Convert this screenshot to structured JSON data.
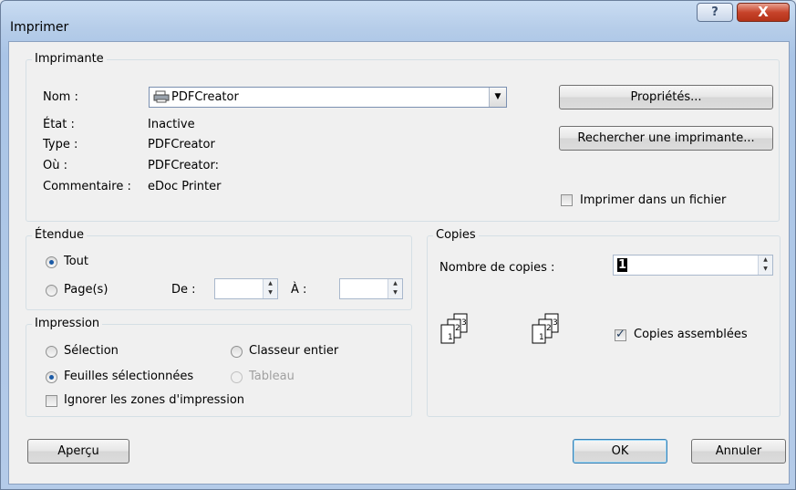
{
  "window": {
    "title": "Imprimer",
    "help_label": "?",
    "close_label": "X"
  },
  "printer": {
    "group_title": "Imprimante",
    "name_label": "Nom :",
    "name_value": "PDFCreator",
    "state_label": "État :",
    "state_value": "Inactive",
    "type_label": "Type :",
    "type_value": "PDFCreator",
    "where_label": "Où :",
    "where_value": "PDFCreator:",
    "comment_label": "Commentaire :",
    "comment_value": "eDoc Printer",
    "properties_button": "Propriétés...",
    "find_printer_button": "Rechercher une imprimante...",
    "print_to_file_label": "Imprimer dans un fichier",
    "print_to_file_checked": false
  },
  "range": {
    "group_title": "Étendue",
    "all_label": "Tout",
    "pages_label": "Page(s)",
    "from_label": "De :",
    "to_label": "À :",
    "from_value": "",
    "to_value": "",
    "selected": "all"
  },
  "print_what": {
    "group_title": "Impression",
    "selection_label": "Sélection",
    "whole_workbook_label": "Classeur entier",
    "active_sheets_label": "Feuilles sélectionnées",
    "table_label": "Tableau",
    "ignore_print_areas_label": "Ignorer les zones d'impression",
    "selected": "active_sheets",
    "ignore_print_areas_checked": false
  },
  "copies": {
    "group_title": "Copies",
    "number_label": "Nombre de copies :",
    "number_value": "1",
    "collate_label": "Copies assemblées",
    "collate_checked": true,
    "icon1_pages": [
      "1",
      "2",
      "3"
    ],
    "icon2_pages": [
      "1",
      "2",
      "3"
    ]
  },
  "footer": {
    "preview_button": "Aperçu",
    "ok_button": "OK",
    "cancel_button": "Annuler"
  },
  "colors": {
    "accent": "#3c7fb1",
    "close": "#c7442b",
    "title_bar": "#b6cde9"
  }
}
